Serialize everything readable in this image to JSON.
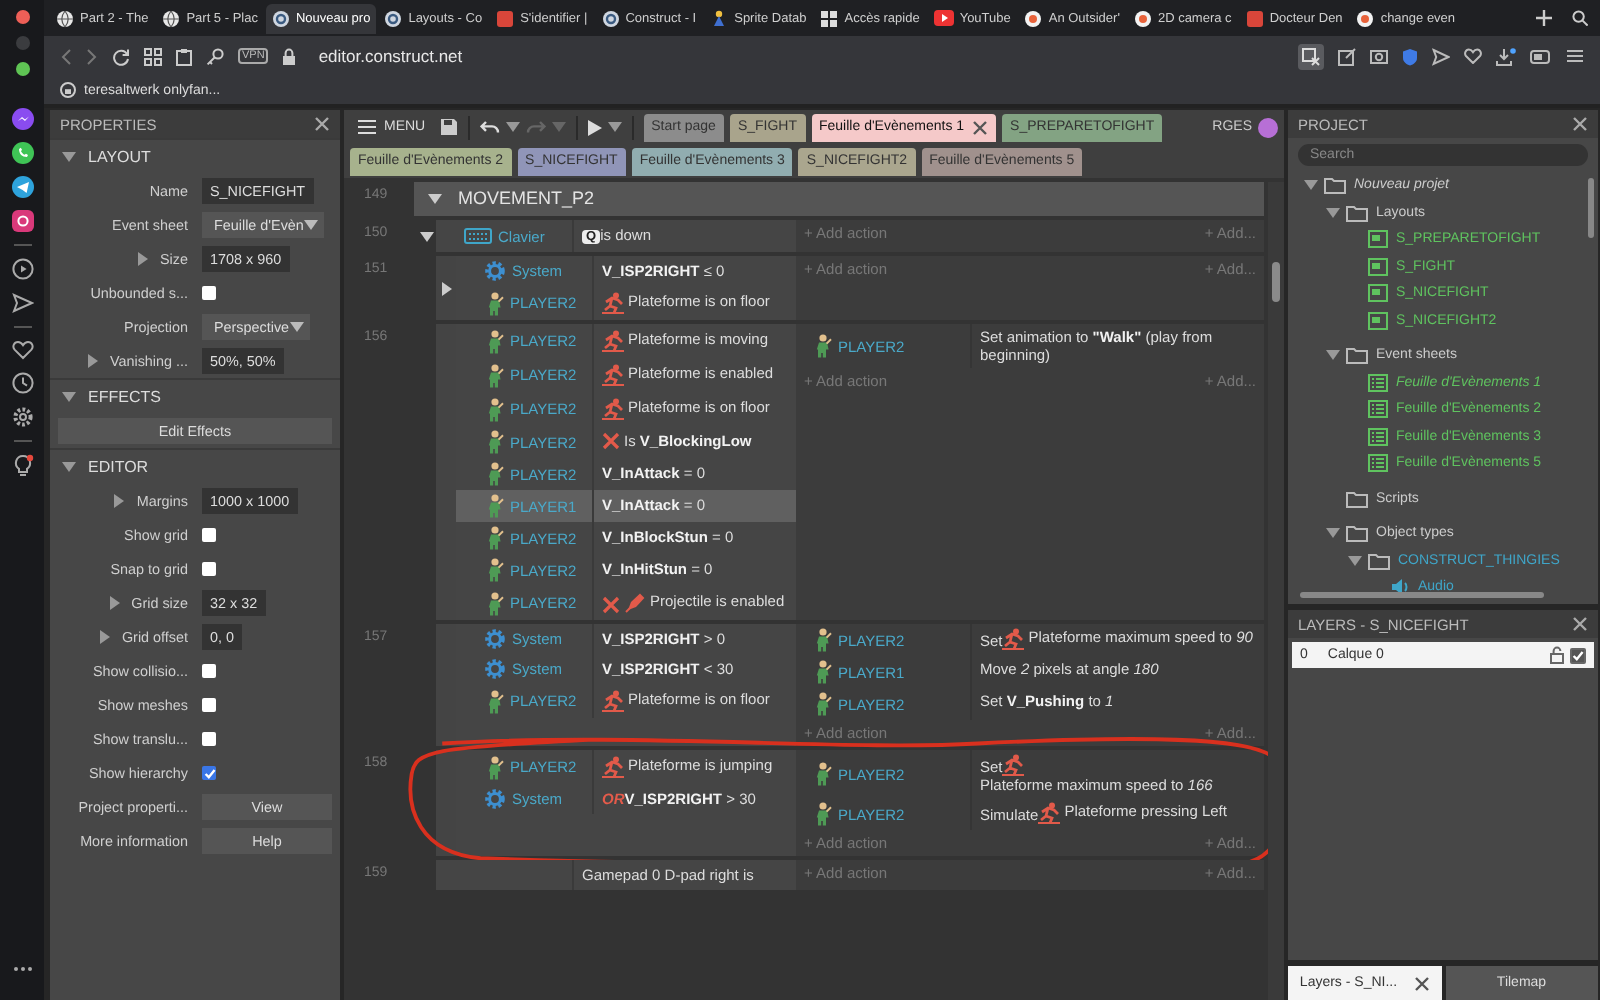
{
  "browser": {
    "tabs": [
      {
        "label": "Part 2 - The",
        "selected": false
      },
      {
        "label": "Part 5 - Plac",
        "selected": false
      },
      {
        "label": "Nouveau pro",
        "selected": true
      },
      {
        "label": "Layouts - Co",
        "selected": false
      },
      {
        "label": "S'identifier |",
        "selected": false
      },
      {
        "label": "Construct - I",
        "selected": false
      },
      {
        "label": "Sprite Datab",
        "selected": false
      },
      {
        "label": "Accès rapide",
        "selected": false
      },
      {
        "label": "YouTube",
        "selected": false
      },
      {
        "label": "An Outsider'",
        "selected": false
      },
      {
        "label": "2D camera c",
        "selected": false
      },
      {
        "label": "Docteur Den",
        "selected": false
      },
      {
        "label": "change even",
        "selected": false
      }
    ],
    "vpn_badge": "VPN",
    "url": "editor.construct.net",
    "bookmark": "teresaltwerk onlyfan..."
  },
  "properties": {
    "title": "PROPERTIES",
    "sections": [
      {
        "title": "LAYOUT",
        "expanded": true,
        "rows": [
          {
            "label": "Name",
            "kind": "text",
            "value": "S_NICEFIGHT",
            "expander": false
          },
          {
            "label": "Event sheet",
            "kind": "select",
            "value": "Feuille d'Evèn",
            "expander": false
          },
          {
            "label": "Size",
            "kind": "text",
            "value": "1708 x 960",
            "expander": true
          },
          {
            "label": "Unbounded s...",
            "kind": "checkbox",
            "checked": false,
            "expander": false
          },
          {
            "label": "Projection",
            "kind": "select",
            "value": "Perspective",
            "expander": false
          },
          {
            "label": "Vanishing ...",
            "kind": "text",
            "value": "50%, 50%",
            "expander": true
          }
        ]
      },
      {
        "title": "EFFECTS",
        "expanded": true,
        "rows": [
          {
            "kind": "button",
            "value": "Edit Effects",
            "expander": false
          }
        ]
      },
      {
        "title": "EDITOR",
        "expanded": true,
        "rows": [
          {
            "label": "Margins",
            "kind": "text",
            "value": "1000 x 1000",
            "expander": true
          },
          {
            "label": "Show grid",
            "kind": "checkbox",
            "checked": false,
            "expander": false
          },
          {
            "label": "Snap to grid",
            "kind": "checkbox",
            "checked": false,
            "expander": false
          },
          {
            "label": "Grid size",
            "kind": "text",
            "value": "32 x 32",
            "expander": true
          },
          {
            "label": "Grid offset",
            "kind": "text",
            "value": "0, 0",
            "expander": true
          },
          {
            "label": "Show collisio...",
            "kind": "checkbox",
            "checked": false,
            "expander": false
          },
          {
            "label": "Show meshes",
            "kind": "checkbox",
            "checked": false,
            "expander": false
          },
          {
            "label": "Show translu...",
            "kind": "checkbox",
            "checked": false,
            "expander": false
          },
          {
            "label": "Show hierarchy",
            "kind": "checkbox",
            "checked": true,
            "expander": false
          },
          {
            "label": "Project properti...",
            "kind": "button",
            "value": "View",
            "expander": false
          },
          {
            "label": "More information",
            "kind": "button",
            "value": "Help",
            "expander": false
          }
        ]
      }
    ]
  },
  "toolbar": {
    "menu": "MENU",
    "user": "RGES"
  },
  "sheet_tab_rows": [
    {
      "tabs": [
        {
          "label": "Start page",
          "color": "#8c8c8c",
          "selected": false
        },
        {
          "label": "S_FIGHT",
          "color": "#a9a48c",
          "selected": false
        },
        {
          "label": "Feuille d'Evènements 1",
          "color": "#f5c9c9",
          "selected": true
        },
        {
          "label": "S_PREPARETOFIGHT",
          "color": "#83a383",
          "selected": false
        }
      ]
    },
    {
      "tabs": [
        {
          "label": "Feuille d'Evènements 2",
          "color": "#a7b28d",
          "selected": false
        },
        {
          "label": "S_NICEFIGHT",
          "color": "#9095b8",
          "selected": false
        },
        {
          "label": "Feuille d'Evènements 3",
          "color": "#91adb0",
          "selected": false
        },
        {
          "label": "S_NICEFIGHT2",
          "color": "#aaa68e",
          "selected": false
        },
        {
          "label": "Feuille d'Evènements 5",
          "color": "#a0918d",
          "selected": false
        }
      ]
    }
  ],
  "events": [
    {
      "kind": "group",
      "line": "149",
      "title": "MOVEMENT_P2",
      "expanded": true
    },
    {
      "kind": "event",
      "line": "150",
      "expanded": true,
      "circled": false,
      "conditions": [
        {
          "object": "Clavier",
          "kind": "keyboard",
          "key": "Q",
          "text": "is down",
          "inverted": false,
          "selected": false
        }
      ],
      "add_action": "+ Add action",
      "add_other": "+ Add...",
      "children": [
        {
          "kind": "event",
          "line": "151",
          "expanded": false,
          "circled": false,
          "conditions": [
            {
              "object": "System",
              "kind": "system",
              "text": "**V_ISP2RIGHT** ≤ 0",
              "inverted": false,
              "selected": false
            },
            {
              "object": "PLAYER2",
              "kind": "platform",
              "text": "Plateforme is on floor",
              "inverted": false,
              "selected": false
            }
          ],
          "add_action": "+ Add action",
          "add_other": "+ Add..."
        },
        {
          "kind": "event",
          "line": "156",
          "circled": false,
          "conditions": [
            {
              "object": "PLAYER2",
              "kind": "platform",
              "text": "Plateforme is moving",
              "inverted": false,
              "selected": false
            },
            {
              "object": "PLAYER2",
              "kind": "platform",
              "text": "Plateforme is enabled",
              "inverted": false,
              "selected": false
            },
            {
              "object": "PLAYER2",
              "kind": "platform",
              "text": "Plateforme is on floor",
              "inverted": false,
              "selected": false
            },
            {
              "object": "PLAYER2",
              "kind": "sprite",
              "text": "Is **V_BlockingLow**",
              "inverted": true,
              "selected": false
            },
            {
              "object": "PLAYER2",
              "kind": "sprite",
              "text": "**V_InAttack** = 0",
              "inverted": false,
              "selected": false
            },
            {
              "object": "PLAYER1",
              "kind": "sprite",
              "text": "**V_InAttack** = 0",
              "inverted": false,
              "selected": true
            },
            {
              "object": "PLAYER2",
              "kind": "sprite",
              "text": "**V_InBlockStun** = 0",
              "inverted": false,
              "selected": false
            },
            {
              "object": "PLAYER2",
              "kind": "sprite",
              "text": "**V_InHitStun** = 0",
              "inverted": false,
              "selected": false
            },
            {
              "object": "PLAYER2",
              "kind": "projectile",
              "text": "Projectile is enabled",
              "inverted": true,
              "selected": false
            }
          ],
          "actions": [
            {
              "object": "PLAYER2",
              "kind": "sprite",
              "text": "Set animation to **\"Walk\"** (play from beginning)"
            }
          ],
          "add_action": "+ Add action",
          "add_other": "+ Add..."
        },
        {
          "kind": "event",
          "line": "157",
          "circled": false,
          "conditions": [
            {
              "object": "System",
              "kind": "system",
              "text": "**V_ISP2RIGHT** > 0",
              "inverted": false,
              "selected": false
            },
            {
              "object": "System",
              "kind": "system",
              "text": "**V_ISP2RIGHT** < 30",
              "inverted": false,
              "selected": false
            },
            {
              "object": "PLAYER2",
              "kind": "platform",
              "text": "Plateforme is on floor",
              "inverted": false,
              "selected": false
            }
          ],
          "actions": [
            {
              "object": "PLAYER2",
              "kind": "platform",
              "lead": "Set",
              "text": "Plateforme maximum speed to *90*"
            },
            {
              "object": "PLAYER1",
              "kind": "sprite",
              "text": "Move *2* pixels at angle *180*"
            },
            {
              "object": "PLAYER2",
              "kind": "sprite",
              "text": "Set **V_Pushing** to *1*"
            }
          ],
          "add_action": "+ Add action",
          "add_other": "+ Add..."
        },
        {
          "kind": "event",
          "line": "158",
          "circled": true,
          "conditions": [
            {
              "object": "PLAYER2",
              "kind": "platform",
              "text": "Plateforme is jumping",
              "inverted": false,
              "selected": false
            },
            {
              "object": "System",
              "kind": "system",
              "prefix": "OR",
              "text": "**V_ISP2RIGHT** > 30",
              "inverted": false,
              "selected": false
            }
          ],
          "actions": [
            {
              "object": "PLAYER2",
              "kind": "platform",
              "lead": "Set",
              "text": "Plateforme maximum speed to *166*"
            },
            {
              "object": "PLAYER2",
              "kind": "platform",
              "lead": "Simulate",
              "text": "Plateforme pressing Left"
            }
          ],
          "add_action": "+ Add action",
          "add_other": "+ Add..."
        }
      ]
    },
    {
      "kind": "event",
      "line": "159",
      "circled": false,
      "conditions": [
        {
          "text": "Gamepad 0 D-pad right is",
          "inverted": false,
          "selected": false
        }
      ],
      "add_action": "+ Add action",
      "add_other": "+ Add..."
    }
  ],
  "project": {
    "title": "PROJECT",
    "search_placeholder": "Search",
    "tree": [
      {
        "label": "Nouveau projet",
        "kind": "project",
        "expanded": true,
        "children": [
          {
            "label": "Layouts",
            "kind": "folder",
            "expanded": true,
            "children": [
              {
                "label": "S_PREPARETOFIGHT",
                "kind": "layout"
              },
              {
                "label": "S_FIGHT",
                "kind": "layout"
              },
              {
                "label": "S_NICEFIGHT",
                "kind": "layout"
              },
              {
                "label": "S_NICEFIGHT2",
                "kind": "layout"
              }
            ]
          },
          {
            "label": "Event sheets",
            "kind": "folder",
            "expanded": true,
            "children": [
              {
                "label": "Feuille d'Evènements 1",
                "kind": "eventsheet",
                "open": true
              },
              {
                "label": "Feuille d'Evènements 2",
                "kind": "eventsheet",
                "open": false
              },
              {
                "label": "Feuille d'Evènements 3",
                "kind": "eventsheet",
                "open": false
              },
              {
                "label": "Feuille d'Evènements 5",
                "kind": "eventsheet",
                "open": false
              }
            ]
          },
          {
            "label": "Scripts",
            "kind": "folder"
          },
          {
            "label": "Object types",
            "kind": "folder",
            "expanded": true,
            "children": [
              {
                "label": "CONSTRUCT_THINGIES",
                "kind": "objectfolder",
                "expanded": true,
                "children": [
                  {
                    "label": "Audio",
                    "kind": "audio"
                  }
                ]
              }
            ]
          }
        ]
      }
    ]
  },
  "layers": {
    "title": "LAYERS - S_NICEFIGHT",
    "rows": [
      {
        "index": "0",
        "name": "Calque 0",
        "visible": true
      }
    ]
  },
  "bottom_tabs": [
    {
      "label": "Layers - S_NI...",
      "selected": true
    },
    {
      "label": "Tilemap",
      "selected": false
    }
  ]
}
